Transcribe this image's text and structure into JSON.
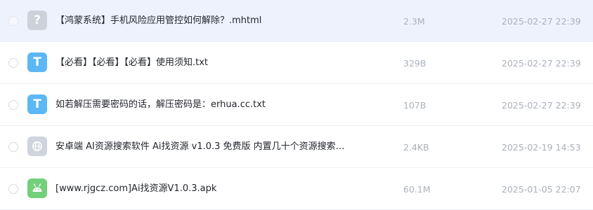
{
  "files": [
    {
      "icon": "unknown-file-icon",
      "icon_glyph": "?",
      "name": "【鸿蒙系统】手机风险应用管控如何解除？.mhtml",
      "size": "2.3M",
      "date": "2025-02-27 22:39",
      "selected": true
    },
    {
      "icon": "txt-file-icon",
      "icon_glyph": "T",
      "name": "【必看】【必看】【必看】使用须知.txt",
      "size": "329B",
      "date": "2025-02-27 22:39",
      "selected": false
    },
    {
      "icon": "txt-file-icon",
      "icon_glyph": "T",
      "name": "如若解压需要密码的话，解压密码是：erhua.cc.txt",
      "size": "107B",
      "date": "2025-02-27 22:39",
      "selected": false
    },
    {
      "icon": "globe-icon",
      "icon_glyph": "",
      "name": "安卓端 AI资源搜索软件 Ai找资源 v1.0.3 免费版 内置几十个资源搜索…",
      "size": "2.4KB",
      "date": "2025-02-19 14:53",
      "selected": false
    },
    {
      "icon": "android-apk-icon",
      "icon_glyph": "",
      "name": "[www.rjgcz.com]Ai找资源V1.0.3.apk",
      "size": "60.1M",
      "date": "2025-01-05 22:07",
      "selected": false
    }
  ],
  "colors": {
    "selected_row_bg": "#eef2fd",
    "txt_icon": "#5cb7f5",
    "apk_icon": "#72d07a",
    "unknown_icon": "#cdd1da",
    "globe_icon": "#cfd4de",
    "meta_text": "#abb1bb"
  }
}
